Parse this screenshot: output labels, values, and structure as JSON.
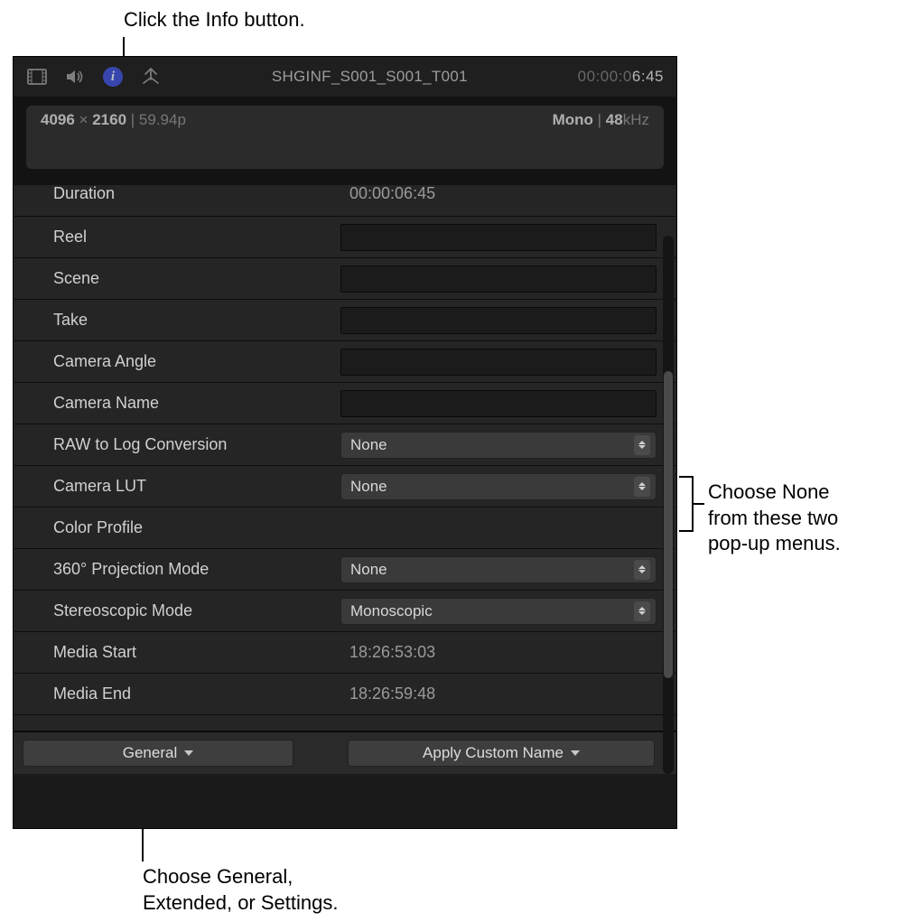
{
  "annotations": {
    "top": "Click the Info button.",
    "right_l1": "Choose None",
    "right_l2": "from these two",
    "right_l3": "pop-up menus.",
    "bottom_l1": "Choose General,",
    "bottom_l2": "Extended, or Settings."
  },
  "toolbar": {
    "clip_name": "SHGINF_S001_S001_T001",
    "time_dim": "00:00:0",
    "time_bright": "6:45"
  },
  "infostrip": {
    "res_a": "4096",
    "res_b": "2160",
    "fps": "59.94p",
    "audio_mode": "Mono",
    "audio_rate": "48",
    "audio_unit": "kHz"
  },
  "fields": {
    "duration": {
      "label": "Duration",
      "value": "00:00:06:45"
    },
    "reel": {
      "label": "Reel",
      "value": ""
    },
    "scene": {
      "label": "Scene",
      "value": ""
    },
    "take": {
      "label": "Take",
      "value": ""
    },
    "camera_angle": {
      "label": "Camera Angle",
      "value": ""
    },
    "camera_name": {
      "label": "Camera Name",
      "value": ""
    },
    "raw_to_log": {
      "label": "RAW to Log Conversion",
      "value": "None"
    },
    "camera_lut": {
      "label": "Camera LUT",
      "value": "None"
    },
    "color_profile": {
      "label": "Color Profile",
      "value": ""
    },
    "projection": {
      "label": "360° Projection Mode",
      "value": "None"
    },
    "stereoscopic": {
      "label": "Stereoscopic Mode",
      "value": "Monoscopic"
    },
    "media_start": {
      "label": "Media Start",
      "value": "18:26:53:03"
    },
    "media_end": {
      "label": "Media End",
      "value": "18:26:59:48"
    }
  },
  "bottom": {
    "general": "General",
    "apply": "Apply Custom Name"
  }
}
